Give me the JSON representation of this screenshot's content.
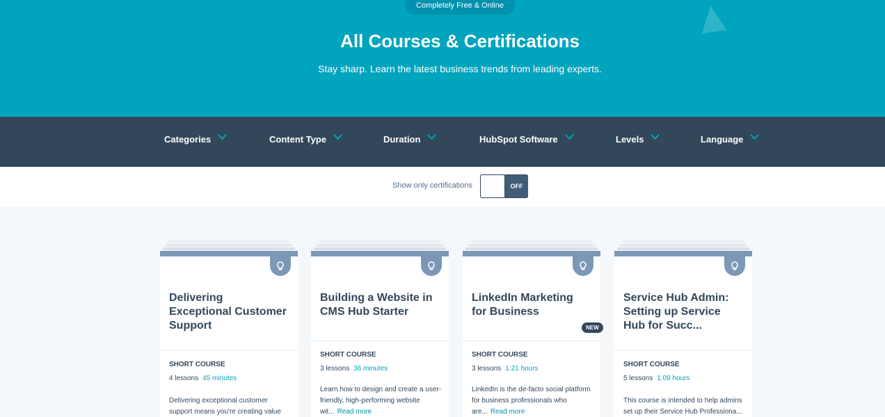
{
  "hero": {
    "pill": "Completely Free & Online",
    "title": "All Courses & Certifications",
    "subtitle": "Stay sharp. Learn the latest business trends from leading experts."
  },
  "filters": [
    {
      "label": "Categories"
    },
    {
      "label": "Content Type"
    },
    {
      "label": "Duration"
    },
    {
      "label": "HubSpot Software"
    },
    {
      "label": "Levels"
    },
    {
      "label": "Language"
    }
  ],
  "toggle": {
    "label": "Show only certifications",
    "state": "OFF"
  },
  "cards": [
    {
      "title": "Delivering Exceptional Customer Support",
      "type": "SHORT COURSE",
      "lessons": "4 lessons",
      "duration": "45 minutes",
      "description": "Delivering exceptional customer support means you're creating value",
      "more": ""
    },
    {
      "title": "Building a Website in CMS Hub Starter",
      "type": "SHORT COURSE",
      "lessons": "3 lessons",
      "duration": "36 minutes",
      "description": "Learn how to design and create a user-friendly, high-performing website wit...",
      "more": "Read more"
    },
    {
      "title": "LinkedIn Marketing for Business",
      "type": "SHORT COURSE",
      "lessons": "3 lessons",
      "duration": "1:21 hours",
      "description": "LinkedIn is the de-facto social platform for business professionals who are...",
      "more": "Read more",
      "badge": "NEW"
    },
    {
      "title": "Service Hub Admin: Setting up Service Hub for Succ...",
      "type": "SHORT COURSE",
      "lessons": "5 lessons",
      "duration": "1:09 hours",
      "description": "This course is intended to help admins set up their Service Hub Professiona...",
      "more": ""
    }
  ],
  "colors": {
    "hero": "#00a4bd",
    "filterbar": "#33475b",
    "accent": "#00bda5",
    "card_top": "#7c98b6"
  }
}
